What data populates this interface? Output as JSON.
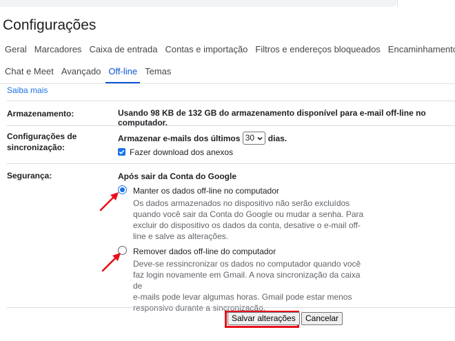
{
  "page": {
    "title": "Configurações"
  },
  "tabs_row1": [
    "Geral",
    "Marcadores",
    "Caixa de entrada",
    "Contas e importação",
    "Filtros e endereços bloqueados",
    "Encaminhamento e P"
  ],
  "tabs_row2": [
    "Chat e Meet",
    "Avançado",
    "Off-line",
    "Temas"
  ],
  "active_tab": "Off-line",
  "learn_more": "Saiba mais",
  "storage": {
    "label": "Armazenamento:",
    "text": "Usando 98 KB de 132 GB do armazenamento disponível para e-mail off-line no computador."
  },
  "sync": {
    "label_line1": "Configurações de",
    "label_line2": "sincronização:",
    "prefix": "Armazenar e-mails dos últimos",
    "days_value": "30",
    "suffix": "dias.",
    "download_label": "Fazer download dos anexos",
    "download_checked": true
  },
  "security": {
    "label": "Segurança:",
    "heading": "Após sair da Conta do Google",
    "option1": {
      "title": "Manter os dados off-line no computador",
      "desc1": "Os dados armazenados no dispositivo não serão excluídos",
      "desc2": "quando você sair da Conta do Google ou mudar a senha. Para",
      "desc3": "excluir do dispositivo os dados da conta, desative o e-mail off-",
      "desc4": "line e salve as alterações.",
      "selected": true
    },
    "option2": {
      "title": "Remover dados off-line do computador",
      "desc1": "Deve-se ressincronizar os dados no computador quando você",
      "desc2": "faz login novamente em Gmail. A nova sincronização da caixa de",
      "desc3": "e-mails pode levar algumas horas. Gmail pode estar menos",
      "desc4": "responsivo durante a sincronização.",
      "selected": false
    }
  },
  "buttons": {
    "save": "Salvar alterações",
    "cancel": "Cancelar"
  },
  "colors": {
    "accent": "#1a73e8",
    "active_tab": "#0b57d0",
    "annotation": "#e8101b"
  }
}
